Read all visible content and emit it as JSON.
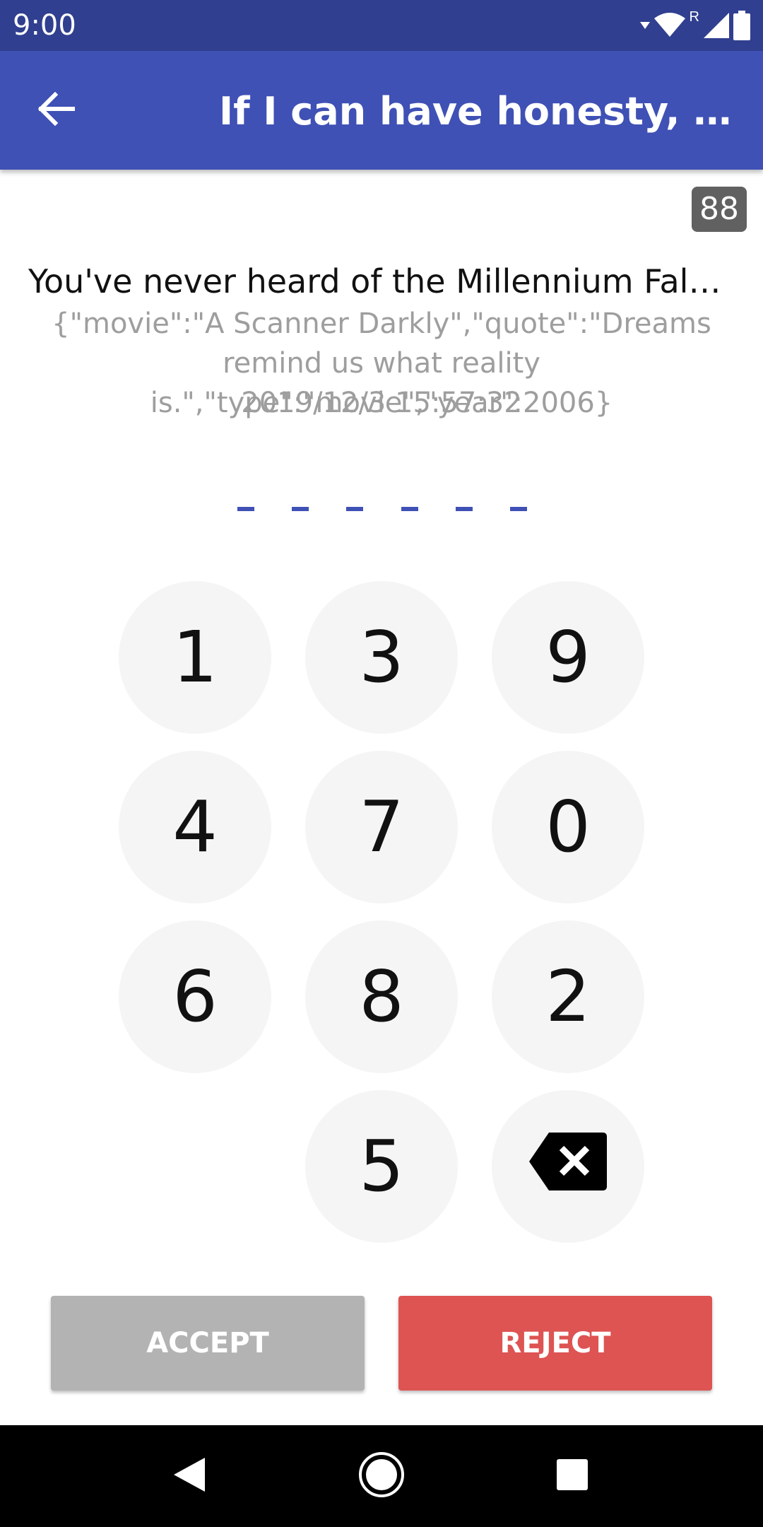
{
  "status_bar": {
    "time": "9:00",
    "roaming_label": "R",
    "icons": [
      "wifi-icon",
      "signal-icon",
      "battery-icon"
    ]
  },
  "app_bar": {
    "title": "If I can have honesty, it's ea…",
    "back_icon": "arrow-back-icon"
  },
  "counter": "88",
  "message": {
    "title": "You've never heard of the Millennium Falcon…",
    "body": "{\"movie\":\"A Scanner Darkly\",\"quote\":\"Dreams remind us what reality is.\",\"type\":\"movie\",\"year\":2006}",
    "timestamp": "2019/12/3 15:57:32"
  },
  "pin": {
    "length": 6,
    "dash_color": "#3f51b5"
  },
  "keypad": {
    "keys": [
      "1",
      "3",
      "9",
      "4",
      "7",
      "0",
      "6",
      "8",
      "2",
      "5"
    ],
    "backspace_icon": "backspace-icon"
  },
  "actions": {
    "accept_label": "ACCEPT",
    "reject_label": "REJECT",
    "accept_color": "#b3b3b3",
    "reject_color": "#dd5453"
  },
  "nav_bar": {
    "icons": [
      "back-triangle-icon",
      "home-circle-icon",
      "recents-square-icon"
    ]
  },
  "colors": {
    "status_bar": "#303f8f",
    "app_bar": "#3f51b5",
    "key_background": "#f5f5f5"
  }
}
